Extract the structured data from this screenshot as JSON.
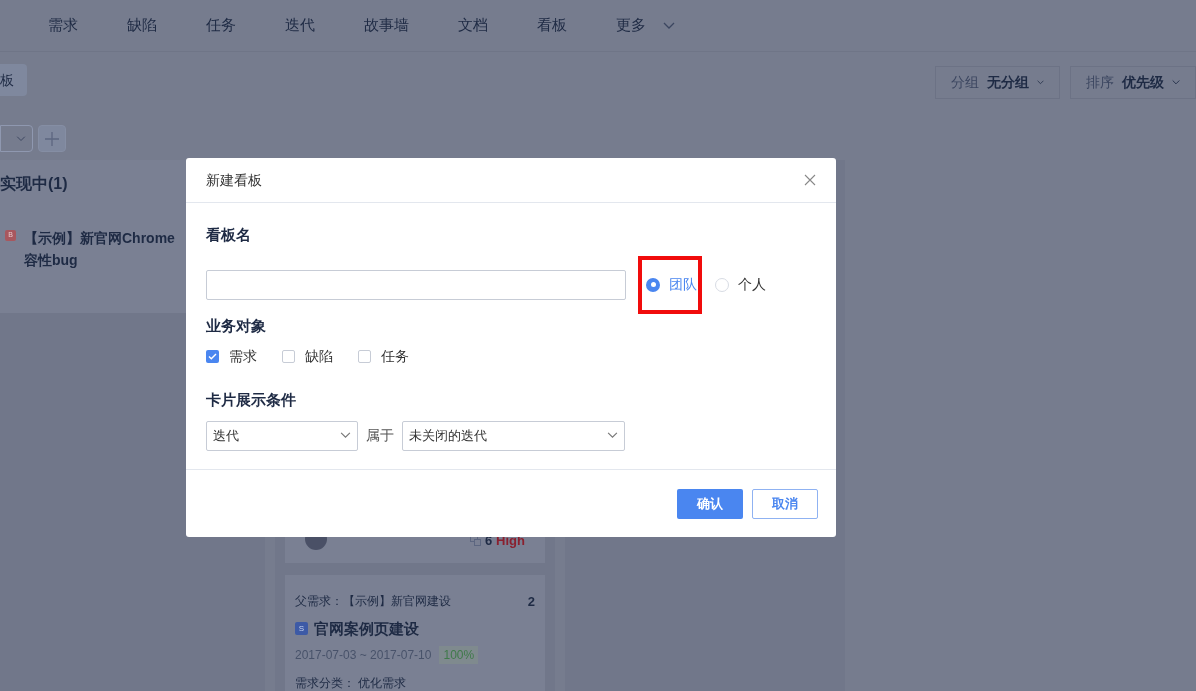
{
  "nav": {
    "items": [
      {
        "label": "需求"
      },
      {
        "label": "缺陷"
      },
      {
        "label": "任务"
      },
      {
        "label": "迭代"
      },
      {
        "label": "故事墙"
      },
      {
        "label": "文档"
      },
      {
        "label": "看板"
      },
      {
        "label": "更多",
        "dropdown": true
      }
    ]
  },
  "view_tab": {
    "label": "板"
  },
  "toolbar": {
    "group": {
      "label": "分组",
      "value": "无分组"
    },
    "sort": {
      "label": "排序",
      "value": "优先级"
    }
  },
  "board": {
    "columns": [
      {
        "title": "实现中(1)",
        "cards": [
          {
            "kind": "bug",
            "tag": "B",
            "title_lines": [
              "【示例】新官网Chrome",
              "容性bug"
            ]
          }
        ]
      },
      {
        "cards": [
          {
            "kind": "footer",
            "count": "6",
            "priority": "High"
          },
          {
            "kind": "story",
            "parent_label": "父需求：",
            "parent": "【示例】新官网建设",
            "number": "2",
            "tag": "S",
            "title": "官网案例页建设",
            "dates": "2017-07-03 ~ 2017-07-10",
            "progress": "100%",
            "category_label": "需求分类：",
            "category": "优化需求"
          }
        ]
      },
      {}
    ]
  },
  "dialog": {
    "title": "新建看板",
    "name_section": {
      "heading": "看板名",
      "scopes": [
        {
          "label": "团队",
          "selected": true,
          "highlighted": true
        },
        {
          "label": "个人",
          "selected": false,
          "highlighted": false
        }
      ]
    },
    "objects_section": {
      "heading": "业务对象",
      "options": [
        {
          "label": "需求",
          "checked": true
        },
        {
          "label": "缺陷",
          "checked": false
        },
        {
          "label": "任务",
          "checked": false
        }
      ]
    },
    "condition_section": {
      "heading": "卡片展示条件",
      "field": "迭代",
      "relation": "属于",
      "value": "未关闭的迭代"
    },
    "buttons": [
      {
        "label": "确认",
        "kind": "primary"
      },
      {
        "label": "取消",
        "kind": "secondary"
      }
    ]
  }
}
